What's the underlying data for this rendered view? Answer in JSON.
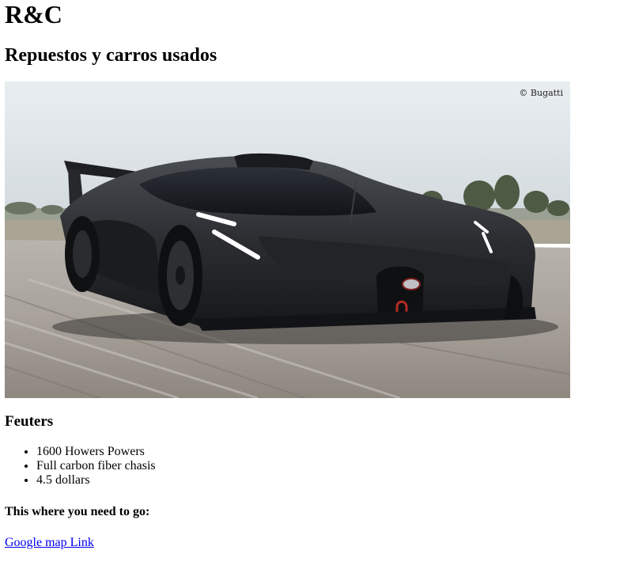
{
  "header": {
    "brand": "R&C",
    "subtitle": "Repuestos y carros usados"
  },
  "hero_image": {
    "credit": "© Bugatti"
  },
  "features": {
    "title": "Feuters",
    "items": [
      "1600 Howers Powers",
      "Full carbon fiber chasis",
      "4.5 dollars"
    ]
  },
  "directions": {
    "label": "This where you need to go:",
    "link_text": "Google map Link"
  }
}
